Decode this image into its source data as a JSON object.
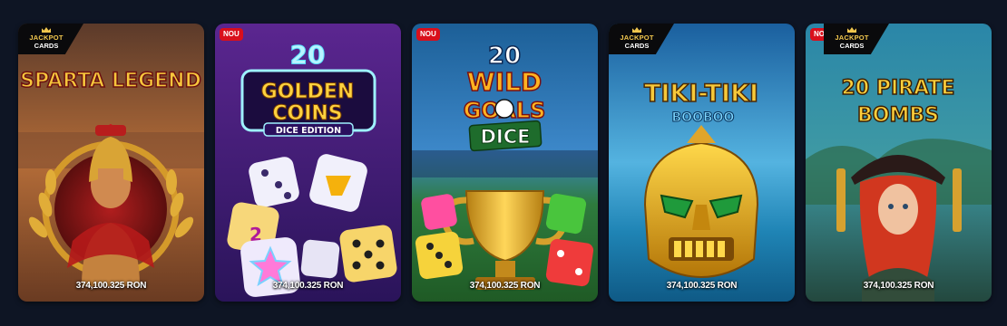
{
  "games": [
    {
      "title_line1": "SPARTA LEGEND",
      "badge": "JACKPOT CARDS",
      "jackpot": "374,100.325 RON",
      "colors": {
        "bg_top": "#7a4a2a",
        "bg_bottom": "#c07a38",
        "accent": "#e4b13a"
      }
    },
    {
      "title_line0": "20",
      "title_line1": "GOLDEN",
      "title_line2": "COINS",
      "title_sub": "DICE EDITION",
      "badge": "NOU",
      "jackpot": "374,100.325 RON",
      "colors": {
        "bg_top": "#4a1f7d",
        "bg_bottom": "#2a1457",
        "accent": "#f4c433"
      }
    },
    {
      "title_line0": "20",
      "title_line1": "WILD",
      "title_line2": "GOALS",
      "title_sub": "DICE",
      "badge": "NOU",
      "jackpot": "374,100.325 RON",
      "colors": {
        "bg_top": "#1b5d8a",
        "bg_bottom": "#2f7d2a",
        "accent": "#f2a52c"
      }
    },
    {
      "title_line1": "TIKI-TIKI",
      "title_sub": "BOOBOO",
      "badge": "JACKPOT CARDS",
      "jackpot": "374,100.325 RON",
      "colors": {
        "bg_top": "#1c6aa8",
        "bg_bottom": "#3aa7d3",
        "accent": "#e9b724"
      }
    },
    {
      "title_line1": "20 PIRATE",
      "title_line2": "BOMBS",
      "badge": "NOU",
      "badge2": "JACKPOT CARDS",
      "jackpot": "374,100.325 RON",
      "colors": {
        "bg_top": "#1f6a86",
        "bg_bottom": "#2f5a47",
        "accent": "#f1c232"
      }
    }
  ],
  "badges": {
    "nou_label": "NOU",
    "jackpot_line1": "JACKPOT",
    "jackpot_line2": "CARDS"
  }
}
